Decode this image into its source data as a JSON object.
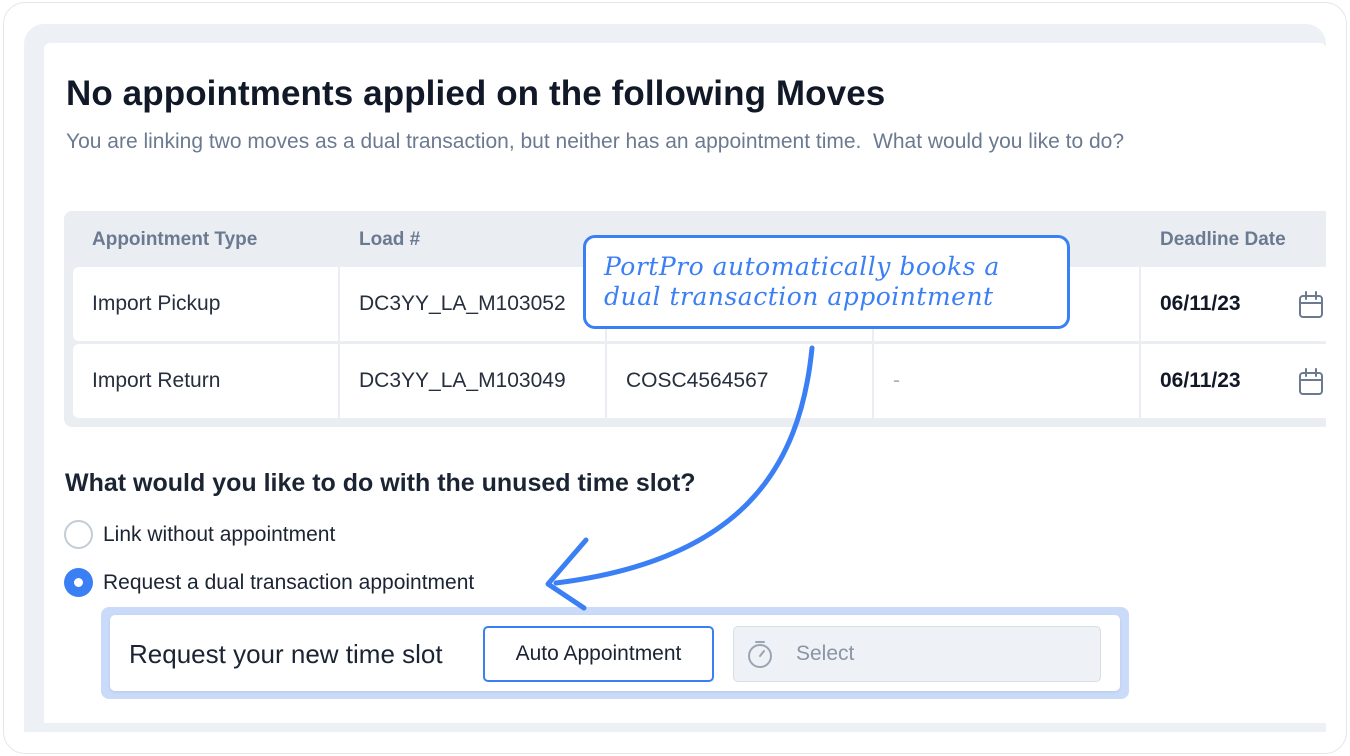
{
  "dialog": {
    "title": "No appointments applied on the following Moves",
    "subtitle": "You are linking two moves as a dual transaction, but neither has an appointment time.  What would you like to do?"
  },
  "table": {
    "headers": [
      "Appointment Type",
      "Load #",
      "",
      "",
      "Deadline Date"
    ],
    "rows": [
      {
        "type": "Import Pickup",
        "load": "DC3YY_LA_M103052",
        "container": "",
        "col4": "",
        "deadline": "06/11/23"
      },
      {
        "type": "Import Return",
        "load": "DC3YY_LA_M103049",
        "container": "COSC4564567",
        "col4": "-",
        "deadline": "06/11/23"
      }
    ]
  },
  "question": "What would you like to do with the unused time slot?",
  "options": [
    {
      "label": "Link without appointment",
      "selected": false
    },
    {
      "label": "Request a dual transaction appointment",
      "selected": true
    }
  ],
  "time_slot": {
    "label": "Request your new time slot",
    "auto_button": "Auto Appointment",
    "select_placeholder": "Select"
  },
  "callout": {
    "line1": "PortPro automatically books a",
    "line2": "dual transaction appointment"
  },
  "colors": {
    "accent": "#3b7ff5",
    "muted_text": "#6b7a90",
    "table_bg": "#eaeef3"
  },
  "icons": [
    "calendar-icon",
    "timer-icon",
    "arrow-annotation"
  ]
}
